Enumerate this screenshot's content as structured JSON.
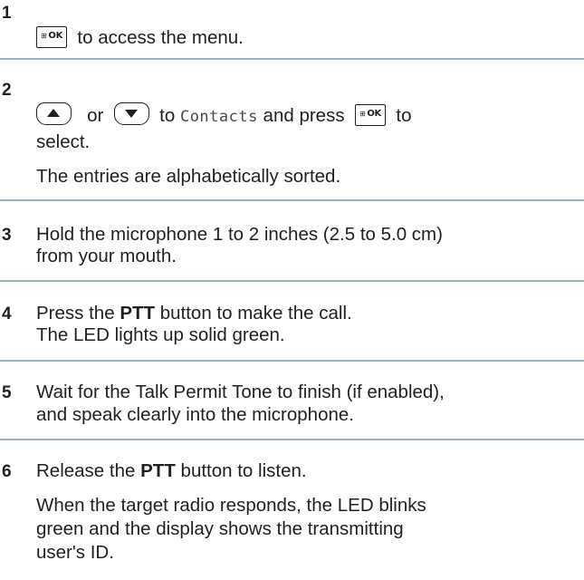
{
  "steps": [
    {
      "number": "1",
      "icon_ok": "OK",
      "text": "to access the menu."
    },
    {
      "number": "2",
      "or": "or",
      "to": "to",
      "menu_item": "Contacts",
      "and_press": "and press",
      "to2": "to",
      "select": "select.",
      "result": "The entries are alphabetically sorted."
    },
    {
      "number": "3",
      "line1": "Hold the microphone 1 to 2 inches (2.5 to 5.0 cm)",
      "line2": "from your mouth."
    },
    {
      "number": "4",
      "pre": "Press the",
      "ptt": "PTT",
      "post": "button to make the call.",
      "result": "The LED lights up solid green."
    },
    {
      "number": "5",
      "line1": "Wait for the Talk Permit Tone to finish (if enabled),",
      "line2": "and speak clearly into the microphone."
    },
    {
      "number": "6",
      "pre": "Release the",
      "ptt": "PTT",
      "post": "button to listen.",
      "result1": "When the target radio responds, the LED blinks",
      "result2": "green and the display shows the transmitting",
      "result3": "user's ID."
    }
  ],
  "icons": {
    "menu_ok": "menu-ok-key-icon",
    "up": "up-arrow-key-icon",
    "down": "down-arrow-key-icon"
  },
  "colors": {
    "text": "#231f20",
    "divider": "#9fb0c4"
  }
}
